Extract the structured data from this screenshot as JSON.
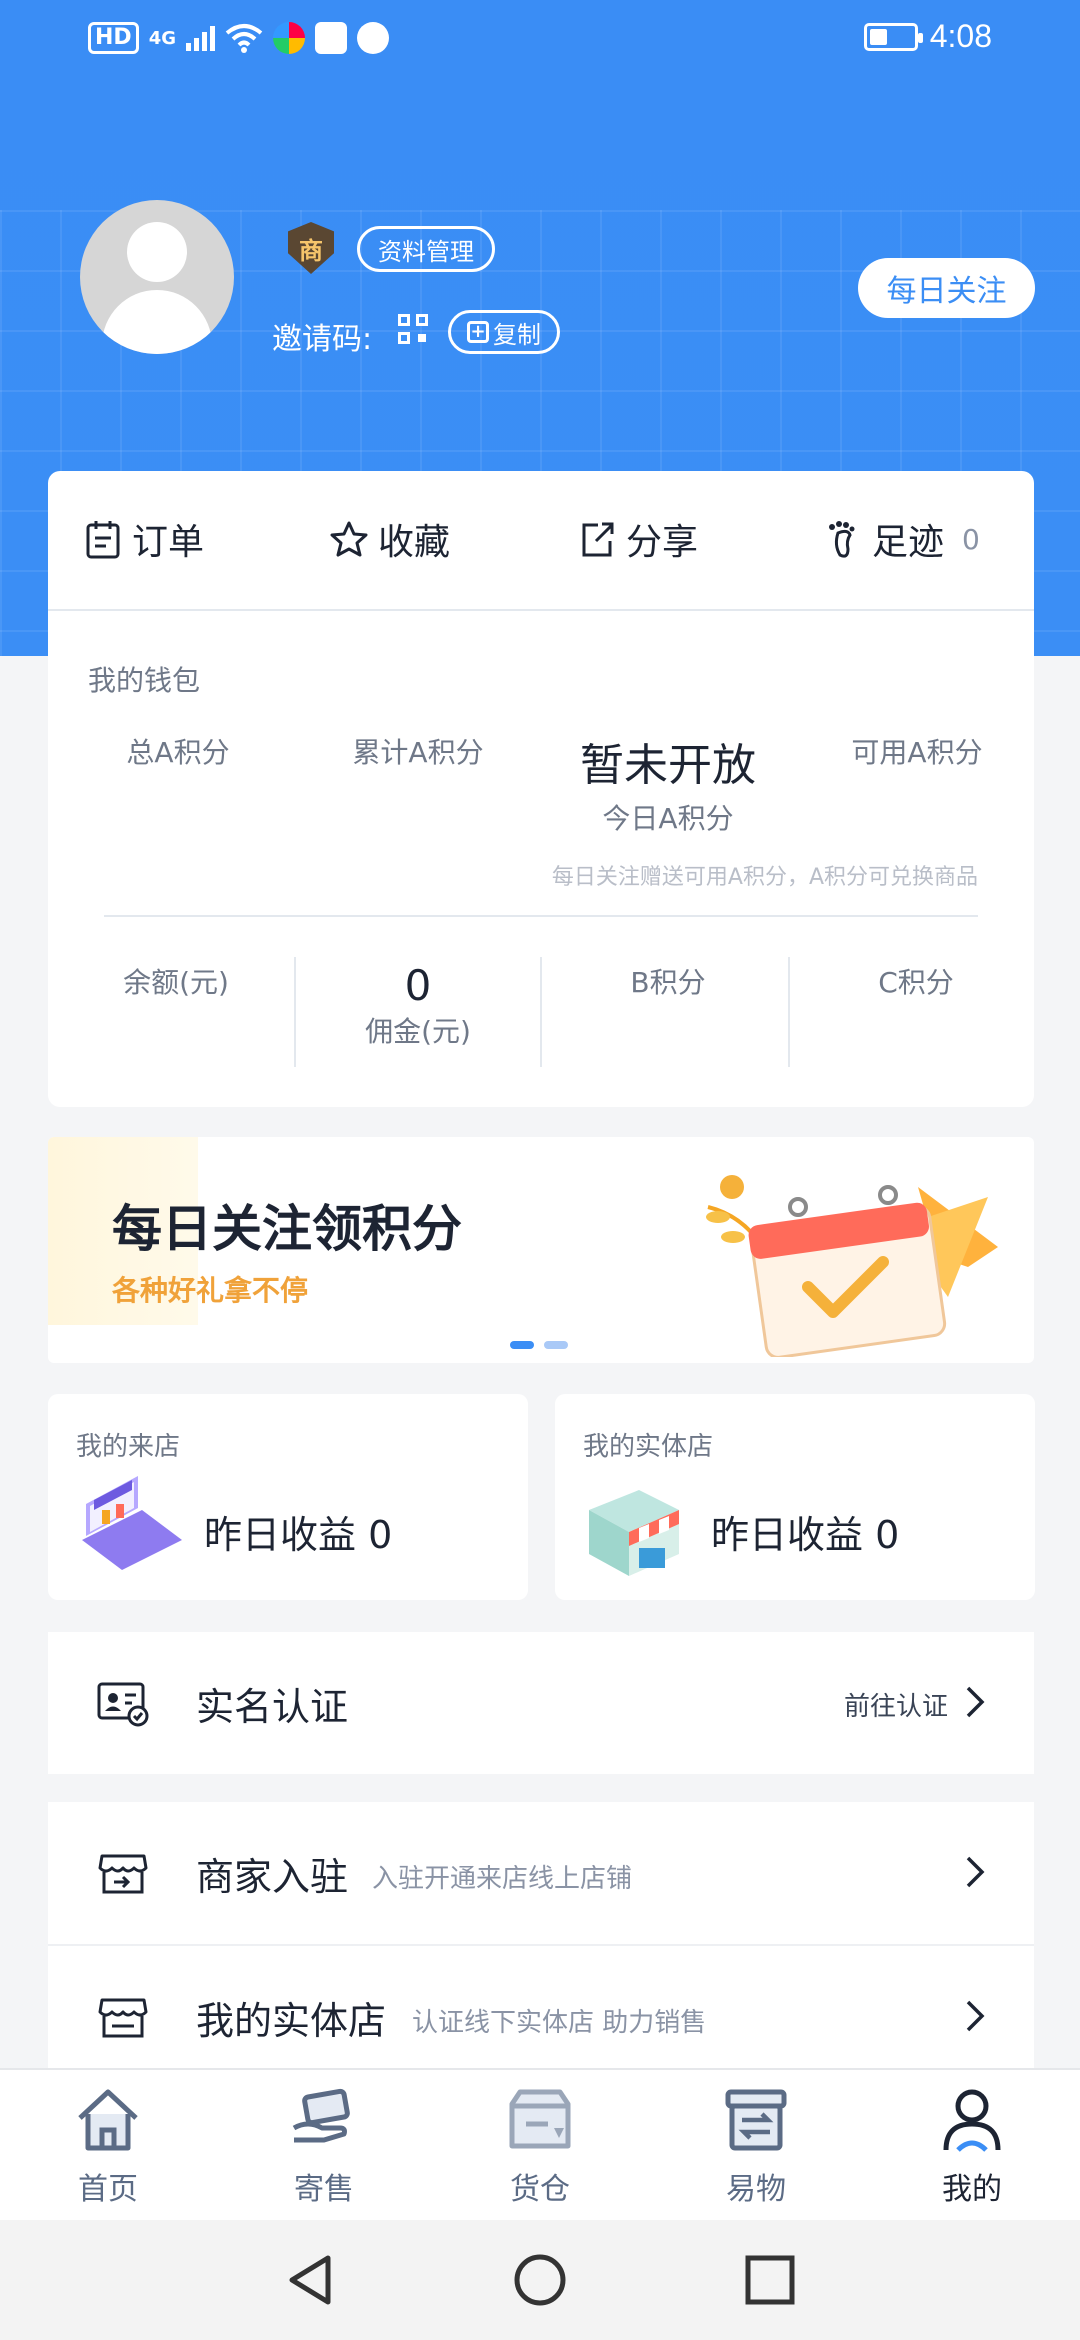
{
  "status_bar": {
    "hd": "HD",
    "network": "4G",
    "time": "4:08",
    "battery_level": 0.35
  },
  "profile": {
    "merchant_badge": "商",
    "manage_label": "资料管理",
    "invite_label": "邀请码:",
    "copy_label": "复制",
    "daily_follow_label": "每日关注"
  },
  "quick_links": [
    {
      "label": "订单",
      "icon": "order-icon"
    },
    {
      "label": "收藏",
      "icon": "star-icon"
    },
    {
      "label": "分享",
      "icon": "share-icon"
    },
    {
      "label": "足迹",
      "icon": "footprint-icon",
      "count": "0"
    }
  ],
  "wallet": {
    "title": "我的钱包",
    "total_a": "总A积分",
    "accum_a": "累计A积分",
    "today_value": "暂未开放",
    "today_label": "今日A积分",
    "available_a": "可用A积分",
    "note": "每日关注赠送可用A积分，A积分可兑换商品",
    "balance_label": "余额(元)",
    "commission_value": "0",
    "commission_label": "佣金(元)",
    "b_points": "B积分",
    "c_points": "C积分"
  },
  "banner": {
    "title": "每日关注领积分",
    "subtitle": "各种好礼拿不停",
    "active_dot": 0
  },
  "stores": [
    {
      "title": "我的来店",
      "value": "昨日收益 0",
      "icon": "laptop-shop-icon"
    },
    {
      "title": "我的实体店",
      "value": "昨日收益 0",
      "icon": "storefront-icon"
    }
  ],
  "rows": {
    "verify": {
      "title": "实名认证",
      "action": "前往认证"
    },
    "merchant": {
      "title": "商家入驻",
      "subtitle": "入驻开通来店线上店铺"
    },
    "physical": {
      "title": "我的实体店",
      "subtitle": "认证线下实体店 助力销售"
    }
  },
  "bottom_nav": [
    {
      "label": "首页",
      "icon": "home-icon"
    },
    {
      "label": "寄售",
      "icon": "consign-icon"
    },
    {
      "label": "货仓",
      "icon": "warehouse-icon"
    },
    {
      "label": "易物",
      "icon": "exchange-icon"
    },
    {
      "label": "我的",
      "icon": "user-icon",
      "active": true
    }
  ],
  "colors": {
    "primary": "#3b8ef5",
    "text_dark": "#1d2433",
    "text_muted": "#6f7888",
    "orange": "#f0a23a"
  }
}
